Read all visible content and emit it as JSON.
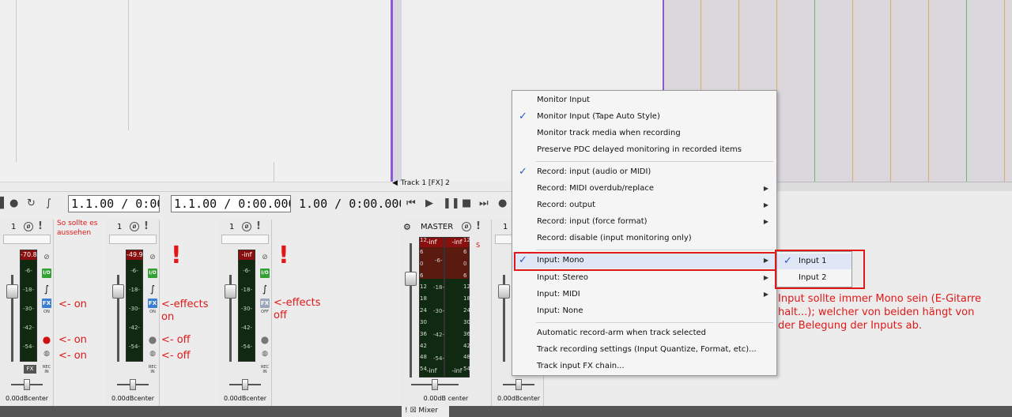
{
  "transport": {
    "time1": "1.1.00 / 0:00",
    "time2": "1.1.00 / 0:00.000",
    "time3": "1.00 / 0:00.000"
  },
  "track_label": "Track 1 [FX] 2",
  "strips": [
    {
      "num": "1",
      "peak": "-70.8",
      "db": "0.00dBcenter"
    },
    {
      "num": "1",
      "peak": "-49.9",
      "db": "0.00dBcenter"
    },
    {
      "num": "1",
      "peak": "-inf",
      "db": "0.00dBcenter"
    }
  ],
  "strip_io": "I/O",
  "strip_fx": "FX",
  "strip_on": "ON",
  "strip_off": "OFF",
  "strip_rec_in": "REC IN",
  "meter_marks": [
    "-6-",
    "-18-",
    "-30-",
    "-42-",
    "-54-"
  ],
  "master": {
    "title": "MASTER",
    "peak_l": "-inf",
    "peak_r": "-inf",
    "bottom_l": "-inf",
    "bottom_r": "-inf",
    "scale": [
      "12",
      "6",
      "0",
      "6",
      "12",
      "18",
      "24",
      "30",
      "36",
      "42",
      "48",
      "54"
    ],
    "scale_r": [
      "12",
      "6",
      "0",
      "6",
      "12",
      "18",
      "24",
      "30",
      "36",
      "42",
      "48",
      "54"
    ],
    "inner": [
      "-6-",
      "-18-",
      "-30-",
      "-42-",
      "-54-"
    ],
    "db": "0.00dB center",
    "s_label": "S"
  },
  "strip4_db": "0.00dBcenter",
  "annotations": {
    "so_sollte": "So sollte es aussehen",
    "on1": "<- on",
    "on2": "<- on",
    "on3": "<- on",
    "effects_on": "<-effects on",
    "off1": "<- off",
    "off2": "<- off",
    "effects_off": "<-effects off",
    "excl": "!",
    "input_note": "Input sollte immer Mono sein (E-Gitarre halt...); welcher von beiden hängt von der Belegung der Inputs ab."
  },
  "menu": {
    "items": [
      {
        "label": "Monitor Input",
        "checked": false,
        "sub": false
      },
      {
        "label": "Monitor Input (Tape Auto Style)",
        "checked": true,
        "sub": false
      },
      {
        "label": "Monitor track media when recording",
        "checked": false,
        "sub": false
      },
      {
        "label": "Preserve PDC delayed monitoring in recorded items",
        "checked": false,
        "sub": false
      },
      {
        "label": "Record: input (audio or MIDI)",
        "checked": true,
        "sub": false
      },
      {
        "label": "Record: MIDI overdub/replace",
        "checked": false,
        "sub": true
      },
      {
        "label": "Record: output",
        "checked": false,
        "sub": true
      },
      {
        "label": "Record: input (force format)",
        "checked": false,
        "sub": true
      },
      {
        "label": "Record: disable (input monitoring only)",
        "checked": false,
        "sub": false
      },
      {
        "label": "Input: Mono",
        "checked": true,
        "sub": true
      },
      {
        "label": "Input: Stereo",
        "checked": false,
        "sub": true
      },
      {
        "label": "Input: MIDI",
        "checked": false,
        "sub": true
      },
      {
        "label": "Input: None",
        "checked": false,
        "sub": false
      },
      {
        "label": "Automatic record-arm when track selected",
        "checked": false,
        "sub": false
      },
      {
        "label": "Track recording settings (Input Quantize, Format, etc)...",
        "checked": false,
        "sub": false
      },
      {
        "label": "Track input FX chain...",
        "checked": false,
        "sub": false
      }
    ],
    "check": "✓",
    "arrow": "▶"
  },
  "submenu": {
    "items": [
      {
        "label": "Input 1",
        "checked": true
      },
      {
        "label": "Input 2",
        "checked": false
      }
    ]
  },
  "mixer_tab": "Mixer",
  "mixer_tab_prefix": "! ☒",
  "colors": {
    "accent_red": "#e01818",
    "menu_check": "#2a58c8",
    "purple": "#8b58d8"
  },
  "icons": [
    "stop-icon",
    "record-icon",
    "repeat-icon",
    "metronome-icon",
    "rewind-icon",
    "play-icon",
    "pause-icon",
    "stop-square-icon",
    "forward-icon"
  ]
}
